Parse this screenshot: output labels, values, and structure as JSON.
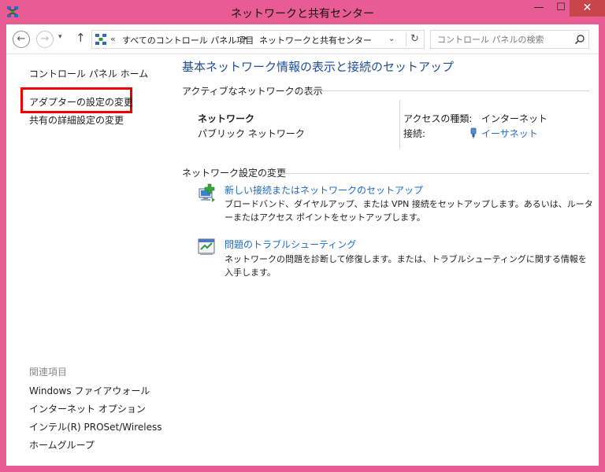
{
  "window": {
    "title": "ネットワークと共有センター",
    "controls": {
      "minimize": "—",
      "maximize": "☐",
      "close": "✕"
    },
    "accent_color": "#e85c93",
    "close_color": "#c7464a"
  },
  "address_bar": {
    "back": "←",
    "forward": "→",
    "recent": "▾",
    "up": "↑",
    "chevron": "«",
    "breadcrumbs": [
      "すべてのコントロール パネル項目",
      "ネットワークと共有センター"
    ],
    "separator": "▸",
    "dropdown": "⌄",
    "refresh": "↻",
    "search_placeholder": "コントロール パネルの検索"
  },
  "sidebar": {
    "home": "コントロール パネル ホーム",
    "adapter_settings": "アダプターの設定の変更",
    "sharing_settings": "共有の詳細設定の変更",
    "related_heading": "関連項目",
    "related": [
      "Windows ファイアウォール",
      "インターネット オプション",
      "インテル(R) PROSet/Wireless",
      "ホームグループ"
    ],
    "highlight_color": "#e00000"
  },
  "main": {
    "title": "基本ネットワーク情報の表示と接続のセットアップ",
    "active_heading": "アクティブなネットワークの表示",
    "network": {
      "name": "ネットワーク",
      "type": "パブリック ネットワーク",
      "access_label": "アクセスの種類:",
      "access_value": "インターネット",
      "connection_label": "接続:",
      "connection_value": "イーサネット"
    },
    "settings_heading": "ネットワーク設定の変更",
    "tasks": [
      {
        "icon": "new-connection-icon",
        "title": "新しい接続またはネットワークのセットアップ",
        "desc": "ブロードバンド、ダイヤルアップ、または VPN 接続をセットアップします。あるいは、ルーターまたはアクセス ポイントをセットアップします。"
      },
      {
        "icon": "troubleshoot-icon",
        "title": "問題のトラブルシューティング",
        "desc": "ネットワークの問題を診断して修復します。または、トラブルシューティングに関する情報を入手します。"
      }
    ],
    "link_color": "#1e6bc4",
    "title_color": "#1e4e99"
  }
}
